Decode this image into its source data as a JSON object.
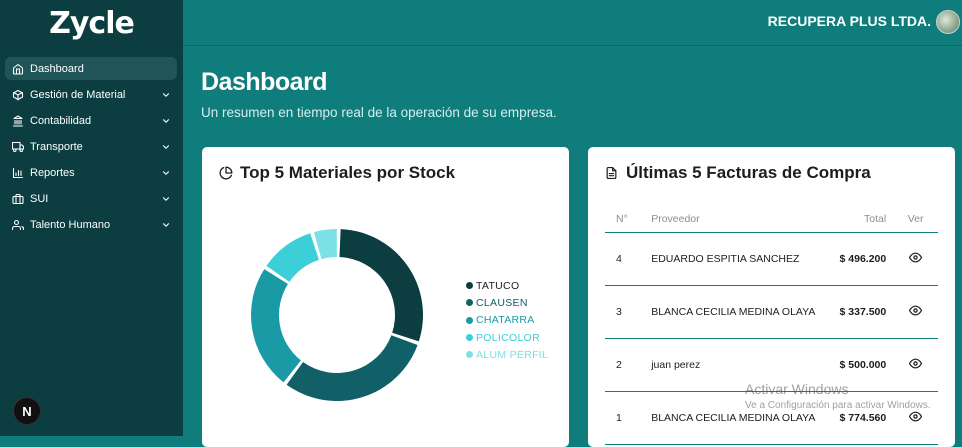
{
  "app": {
    "logo": "Zycle",
    "company": "RECUPERA PLUS LTDA."
  },
  "sidebar": {
    "items": [
      {
        "label": "Dashboard",
        "icon": "home-icon",
        "active": true,
        "expandable": false
      },
      {
        "label": "Gestión de Material",
        "icon": "box-icon",
        "expandable": true
      },
      {
        "label": "Contabilidad",
        "icon": "bank-icon",
        "expandable": true
      },
      {
        "label": "Transporte",
        "icon": "truck-icon",
        "expandable": true
      },
      {
        "label": "Reportes",
        "icon": "bar-chart-icon",
        "expandable": true
      },
      {
        "label": "SUI",
        "icon": "briefcase-icon",
        "expandable": true
      },
      {
        "label": "Talento Humano",
        "icon": "users-icon",
        "expandable": true
      }
    ],
    "badge": "N"
  },
  "header": {
    "title": "Dashboard",
    "subtitle": "Un resumen en tiempo real de la operación de su empresa."
  },
  "materials_card": {
    "title": "Top 5 Materiales por Stock",
    "icon": "pie-chart-icon"
  },
  "chart_data": {
    "type": "pie",
    "categories": [
      "TATUCO",
      "CLAUSEN",
      "CHATARRA",
      "POLICOLOR",
      "ALUM PERFIL"
    ],
    "values": [
      30,
      30,
      24,
      11,
      5
    ],
    "colors": [
      "#0b3d41",
      "#116068",
      "#1a9aa5",
      "#3ccfd8",
      "#7ce0e6"
    ]
  },
  "invoices_card": {
    "title": "Últimas 5 Facturas de Compra",
    "icon": "file-text-icon",
    "columns": [
      "N°",
      "Proveedor",
      "Total",
      "Ver"
    ],
    "rows": [
      {
        "num": "4",
        "proveedor": "EDUARDO ESPITIA SANCHEZ",
        "total": "$ 496.200"
      },
      {
        "num": "3",
        "proveedor": "BLANCA CECILIA MEDINA OLAYA",
        "total": "$ 337.500"
      },
      {
        "num": "2",
        "proveedor": "juan perez",
        "total": "$ 500.000"
      },
      {
        "num": "1",
        "proveedor": "BLANCA CECILIA MEDINA OLAYA",
        "total": "$ 774.560"
      }
    ]
  },
  "watermark": {
    "line1": "Activar Windows",
    "line2": "Ve a Configuración para activar Windows."
  }
}
